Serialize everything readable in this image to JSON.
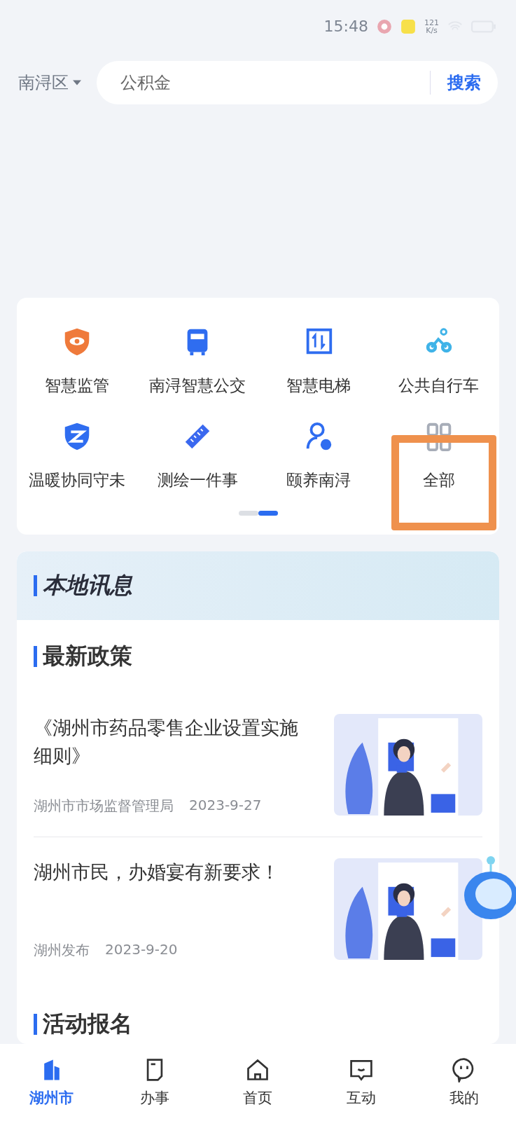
{
  "status_bar": {
    "time": "15:48",
    "speed": "121\nK/s"
  },
  "location": {
    "label": "南浔区"
  },
  "search": {
    "placeholder": "公积金",
    "button": "搜索"
  },
  "services": [
    {
      "label": "智慧监管",
      "kind": "shield-eye",
      "highlighted": false
    },
    {
      "label": "南浔智慧公交",
      "kind": "bus",
      "highlighted": false
    },
    {
      "label": "智慧电梯",
      "kind": "elevator",
      "highlighted": false
    },
    {
      "label": "公共自行车",
      "kind": "bike",
      "highlighted": false
    },
    {
      "label": "温暖协同守未",
      "kind": "shield",
      "highlighted": false
    },
    {
      "label": "测绘一件事",
      "kind": "ruler",
      "highlighted": false
    },
    {
      "label": "颐养南浔",
      "kind": "person",
      "highlighted": false
    },
    {
      "label": "全部",
      "kind": "grid",
      "highlighted": true
    }
  ],
  "pager": [
    {
      "selected": false
    },
    {
      "selected": true
    }
  ],
  "local_news": {
    "title": "本地讯息",
    "section": "最新政策",
    "items": [
      {
        "title": "《湖州市药品零售企业设置实施细则》",
        "source": "湖州市市场监督管理局",
        "date": "2023-9-27"
      },
      {
        "title": "湖州市民，办婚宴有新要求！",
        "source": "湖州发布",
        "date": "2023-9-20"
      }
    ],
    "next_section": "活动报名"
  },
  "tabs": [
    {
      "label": "湖州市",
      "kind": "city",
      "selected": true
    },
    {
      "label": "办事",
      "kind": "doc",
      "selected": false
    },
    {
      "label": "首页",
      "kind": "home",
      "selected": false
    },
    {
      "label": "互动",
      "kind": "chat",
      "selected": false
    },
    {
      "label": "我的",
      "kind": "me",
      "selected": false
    }
  ]
}
